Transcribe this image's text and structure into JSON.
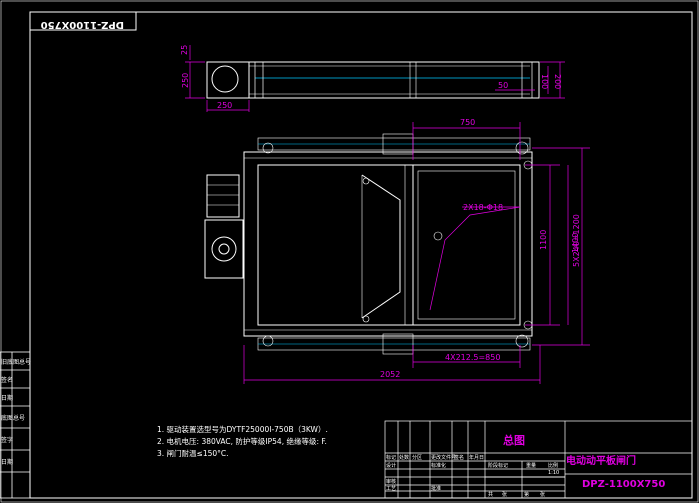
{
  "drawing": {
    "drawing_number_mirrored": "DPZ-1100X750",
    "title_block": {
      "drawing_name": "总图",
      "product_name": "电动动平板闸门",
      "drawing_number": "DPZ-1100X750",
      "small_labels": [
        "标记",
        "处数",
        "分区",
        "更改文件号",
        "签名",
        "年月日",
        "设计",
        "标准化",
        "阶段标记",
        "重量",
        "比例",
        "审核",
        "工艺",
        "批准",
        "共",
        "张",
        "第",
        "张",
        "1:10"
      ]
    },
    "left_margin_labels": [
      "旧底图总号",
      "签名",
      "日期",
      "底图总号",
      "签字",
      "日期"
    ],
    "notes": [
      "1. 驱动装置选型号为DYTF25000I-750B（3KW）.",
      "2. 电机电压: 380VAC, 防护等级IP54, 绝缘等级: F.",
      "3. 闸门耐温≤150°C."
    ],
    "dimensions": {
      "top_view": [
        "25",
        "250",
        "250",
        "100",
        "200",
        "50"
      ],
      "front_view": [
        "750",
        "2X18-Φ18",
        "1100",
        "5X240=1200",
        "1400",
        "4X212.5=850",
        "2052"
      ]
    },
    "colors": {
      "background": "#000000",
      "frame": "#ffffff",
      "dimension": "#e000e0",
      "text": "#e6e600"
    }
  }
}
